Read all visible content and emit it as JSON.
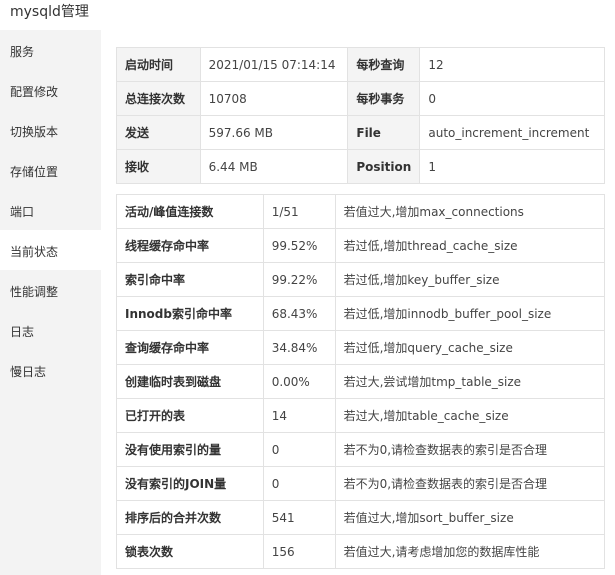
{
  "app": {
    "title": "mysqld管理"
  },
  "sidebar": {
    "items": [
      {
        "label": "服务"
      },
      {
        "label": "配置修改"
      },
      {
        "label": "切换版本"
      },
      {
        "label": "存储位置"
      },
      {
        "label": "端口"
      },
      {
        "label": "当前状态",
        "active": true
      },
      {
        "label": "性能调整"
      },
      {
        "label": "日志"
      },
      {
        "label": "慢日志"
      }
    ]
  },
  "info": {
    "rows": [
      {
        "k1": "启动时间",
        "v1": "2021/01/15 07:14:14",
        "k2": "每秒查询",
        "v2": "12"
      },
      {
        "k1": "总连接次数",
        "v1": "10708",
        "k2": "每秒事务",
        "v2": "0"
      },
      {
        "k1": "发送",
        "v1": "597.66 MB",
        "k2": "File",
        "v2": "auto_increment_increment"
      },
      {
        "k1": "接收",
        "v1": "6.44 MB",
        "k2": "Position",
        "v2": "1"
      }
    ]
  },
  "stats": {
    "rows": [
      {
        "name": "活动/峰值连接数",
        "value": "1/51",
        "advice": "若值过大,增加max_connections"
      },
      {
        "name": "线程缓存命中率",
        "value": "99.52%",
        "advice": "若过低,增加thread_cache_size"
      },
      {
        "name": "索引命中率",
        "value": "99.22%",
        "advice": "若过低,增加key_buffer_size"
      },
      {
        "name": "Innodb索引命中率",
        "value": "68.43%",
        "advice": "若过低,增加innodb_buffer_pool_size"
      },
      {
        "name": "查询缓存命中率",
        "value": "34.84%",
        "advice": "若过低,增加query_cache_size"
      },
      {
        "name": "创建临时表到磁盘",
        "value": "0.00%",
        "advice": "若过大,尝试增加tmp_table_size"
      },
      {
        "name": "已打开的表",
        "value": "14",
        "advice": "若过大,增加table_cache_size"
      },
      {
        "name": "没有使用索引的量",
        "value": "0",
        "advice": "若不为0,请检查数据表的索引是否合理"
      },
      {
        "name": "没有索引的JOIN量",
        "value": "0",
        "advice": "若不为0,请检查数据表的索引是否合理"
      },
      {
        "name": "排序后的合并次数",
        "value": "541",
        "advice": "若值过大,增加sort_buffer_size"
      },
      {
        "name": "锁表次数",
        "value": "156",
        "advice": "若值过大,请考虑增加您的数据库性能"
      }
    ]
  }
}
